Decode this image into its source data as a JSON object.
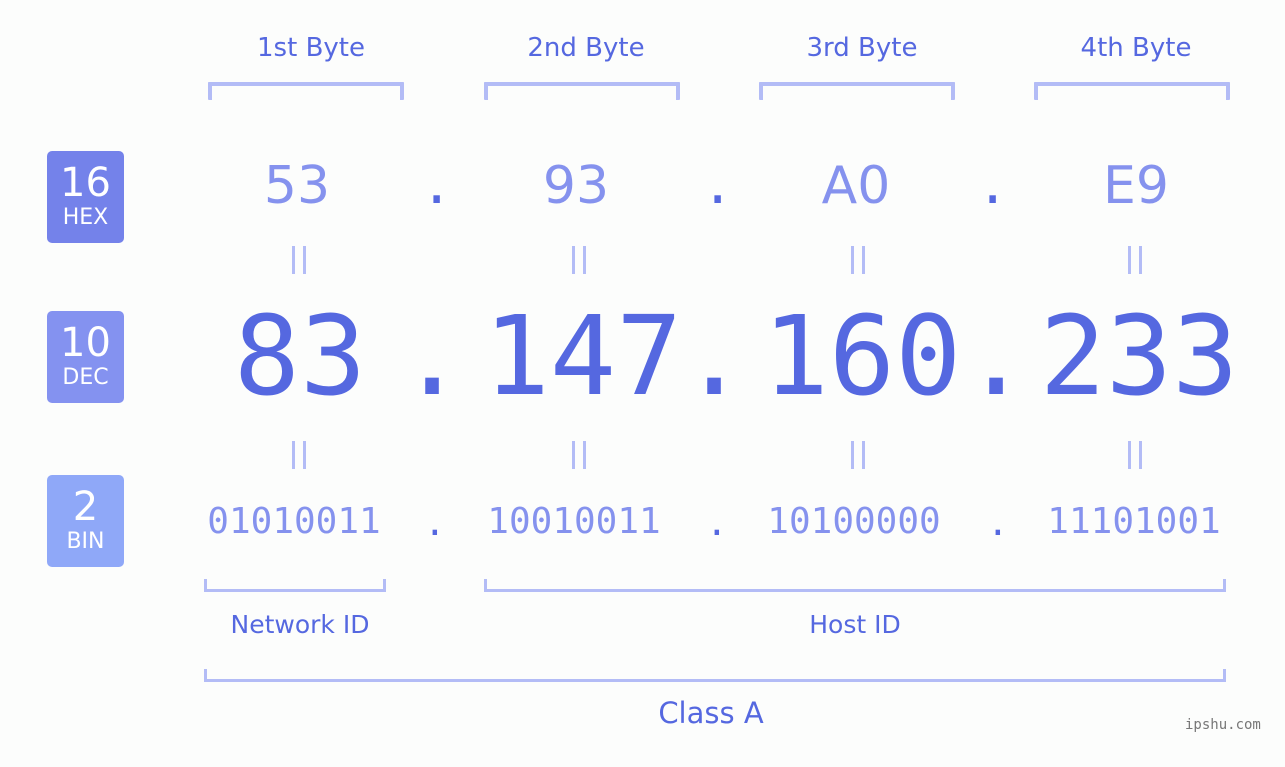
{
  "byte_headers": [
    "1st Byte",
    "2nd Byte",
    "3rd Byte",
    "4th Byte"
  ],
  "badges": [
    {
      "base": "16",
      "label": "HEX"
    },
    {
      "base": "10",
      "label": "DEC"
    },
    {
      "base": "2",
      "label": "BIN"
    }
  ],
  "ip": {
    "hex": [
      "53",
      "93",
      "A0",
      "E9"
    ],
    "dec": [
      "83",
      "147",
      "160",
      "233"
    ],
    "bin": [
      "01010011",
      "10010011",
      "10100000",
      "11101001"
    ],
    "separator": ".",
    "equals": "="
  },
  "segments": {
    "network_id": "Network ID",
    "host_id": "Host ID",
    "class": "Class A"
  },
  "colors": {
    "accent": "#5568e0",
    "light_accent": "#8592ee",
    "bracket": "#b3bcf6",
    "badge_hex": "#7482ea",
    "badge_dec": "#8492f0",
    "badge_bin": "#8fa8f8"
  },
  "watermark": "ipshu.com"
}
